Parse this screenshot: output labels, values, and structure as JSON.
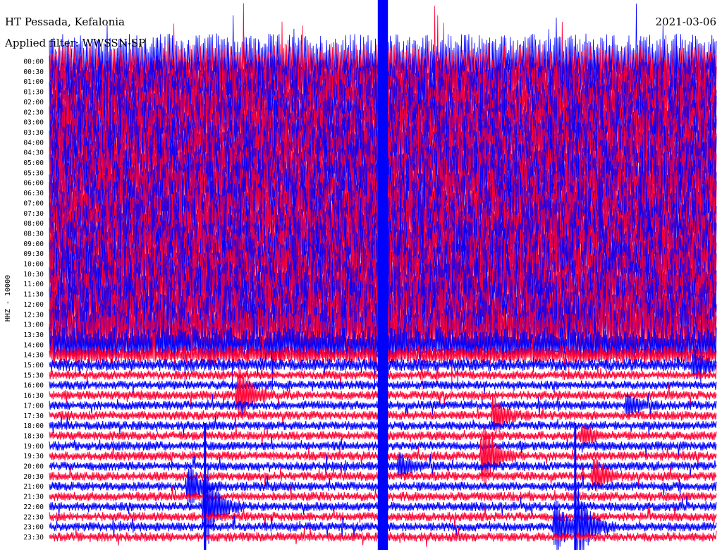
{
  "header": {
    "station": "HT Pessada, Kefalonia",
    "filter": "Applied filter: WWSSN-SP",
    "date": "2021-03-06"
  },
  "chart_data": {
    "type": "line",
    "title": "HT Pessada, Kefalonia",
    "subtitle": "Applied filter: WWSSN-SP",
    "date": "2021-03-06",
    "ylabel": "HHZ - 10000",
    "xlabel": "",
    "x_unit": "minutes past the hour (0-60)",
    "tick_labels": [
      "00:00",
      "00:30",
      "01:00",
      "01:30",
      "02:00",
      "02:30",
      "03:00",
      "03:30",
      "04:00",
      "04:30",
      "05:00",
      "05:30",
      "06:00",
      "06:30",
      "07:00",
      "07:30",
      "08:00",
      "08:30",
      "09:00",
      "09:30",
      "10:00",
      "10:30",
      "11:00",
      "11:30",
      "12:00",
      "12:30",
      "13:00",
      "13:30",
      "14:00",
      "14:30",
      "15:00",
      "15:30",
      "16:00",
      "16:30",
      "17:00",
      "17:30",
      "18:00",
      "18:30",
      "19:00",
      "19:30",
      "20:00",
      "20:30",
      "21:00",
      "21:30",
      "22:00",
      "22:30",
      "23:00",
      "23:30"
    ],
    "colors": [
      "#0000ff",
      "#ff0033"
    ],
    "color_order": "alternating traces starting with blue at 00:00",
    "noise_level_by_trace": [
      9,
      9,
      9,
      9,
      9,
      9,
      9,
      9,
      9,
      9,
      9,
      9,
      9,
      9,
      9,
      9,
      9,
      9,
      9,
      9,
      9,
      9,
      9,
      9,
      9,
      9,
      9,
      9,
      6,
      3,
      2,
      1.5,
      1.5,
      1.5,
      1.5,
      1.5,
      1.5,
      1.5,
      1.5,
      1.5,
      1.5,
      1.5,
      1.5,
      1.5,
      1.5,
      1.5,
      1.5,
      1.5
    ],
    "events": [
      {
        "trace": "16:30",
        "minute": 17,
        "peak_amplitude": 1.5,
        "description": "spindle"
      },
      {
        "trace": "17:30",
        "minute": 40,
        "peak_amplitude": 1.0,
        "description": "spindle"
      },
      {
        "trace": "19:30",
        "minute": 39,
        "peak_amplitude": 1.8,
        "description": "spindle"
      },
      {
        "trace": "20:00",
        "minute": 31.5,
        "peak_amplitude": 0.6,
        "description": "spindle"
      },
      {
        "trace": "20:30",
        "minute": 49,
        "peak_amplitude": 0.9,
        "description": "spindle"
      },
      {
        "trace": "21:00",
        "minute": 12.5,
        "peak_amplitude": 1.2,
        "description": "spindle"
      },
      {
        "trace": "22:00",
        "minute": 14,
        "peak_amplitude": 2.4,
        "description": "large spindle"
      },
      {
        "trace": "23:00",
        "minute": 45.5,
        "peak_amplitude": 1.3,
        "description": "spindle"
      },
      {
        "trace": "23:00",
        "minute": 47.5,
        "peak_amplitude": 2.0,
        "description": "spindle"
      },
      {
        "trace": "18:30",
        "minute": 48,
        "peak_amplitude": 0.5,
        "description": "spindle"
      },
      {
        "trace": "17:00",
        "minute": 52,
        "peak_amplitude": 0.6,
        "description": "spindle"
      },
      {
        "trace": "15:00",
        "minute": 58,
        "peak_amplitude": 0.5,
        "description": "spindle"
      }
    ],
    "through_spikes_minutes": [
      29.8,
      30.2,
      14,
      47.3
    ],
    "grid": false,
    "legend": "none"
  }
}
